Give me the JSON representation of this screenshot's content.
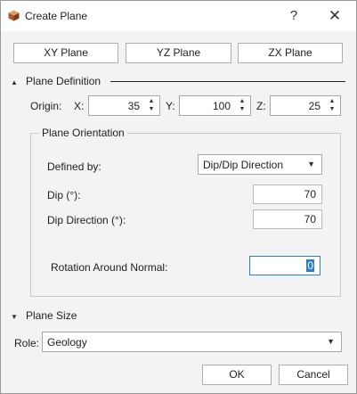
{
  "window": {
    "title": "Create Plane",
    "help": "?",
    "close": "✕"
  },
  "presets": {
    "xy": "XY Plane",
    "yz": "YZ Plane",
    "zx": "ZX Plane"
  },
  "plane_definition": {
    "header": "Plane Definition",
    "origin_label": "Origin:",
    "x_label": "X:",
    "x_value": "35",
    "y_label": "Y:",
    "y_value": "100",
    "z_label": "Z:",
    "z_value": "25"
  },
  "orientation": {
    "title": "Plane Orientation",
    "defined_by_label": "Defined by:",
    "defined_by_value": "Dip/Dip Direction",
    "dip_label": "Dip (°):",
    "dip_value": "70",
    "dip_dir_label": "Dip Direction (°):",
    "dip_dir_value": "70",
    "rotation_label": "Rotation Around Normal:",
    "rotation_value": "0"
  },
  "plane_size": {
    "header": "Plane Size"
  },
  "role": {
    "label": "Role:",
    "value": "Geology"
  },
  "footer": {
    "ok": "OK",
    "cancel": "Cancel"
  }
}
